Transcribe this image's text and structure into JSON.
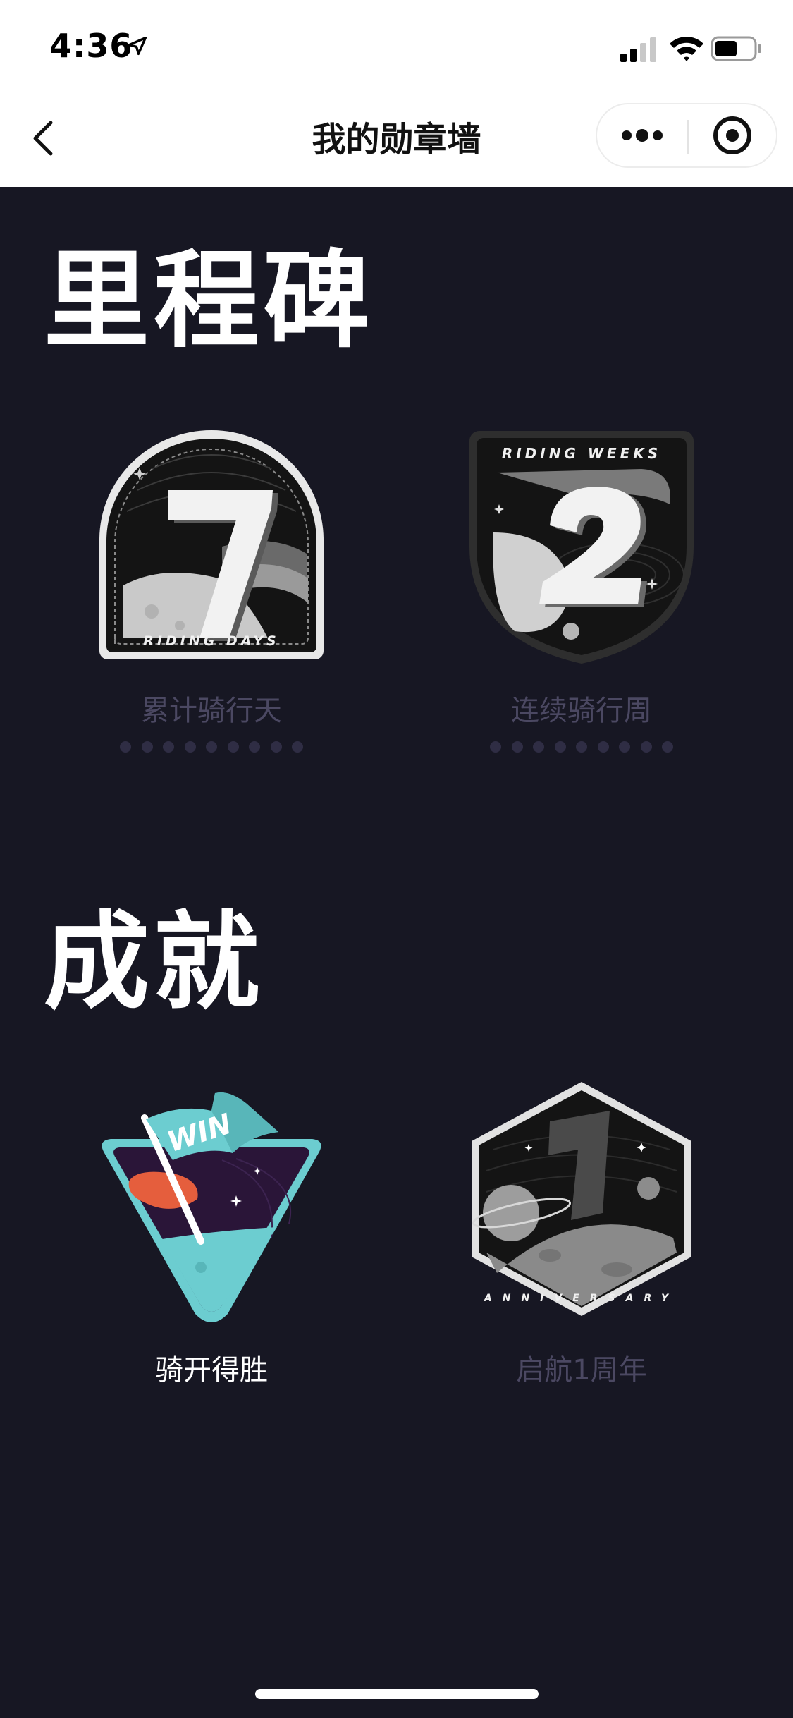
{
  "status_bar": {
    "time": "4:36"
  },
  "nav": {
    "title": "我的勋章墙"
  },
  "sections": {
    "milestones": {
      "title": "里程碑",
      "badges": [
        {
          "number": "7",
          "caption": "RIDING DAYS",
          "label": "累计骑行天",
          "progress_dots": 9
        },
        {
          "number": "2",
          "caption": "RIDING WEEKS",
          "label": "连续骑行周",
          "progress_dots": 9
        }
      ]
    },
    "achievements": {
      "title": "成就",
      "badges": [
        {
          "flag_text": "WIN",
          "label": "骑开得胜",
          "unlocked": true
        },
        {
          "number": "1",
          "caption": "ANNIVERSARY",
          "label": "启航1周年",
          "unlocked": false
        }
      ]
    }
  },
  "colors": {
    "background": "#171723",
    "muted_label": "#4b4862",
    "teal": "#6ccdd0",
    "orange": "#e55e3d",
    "purple": "#2a1538"
  }
}
